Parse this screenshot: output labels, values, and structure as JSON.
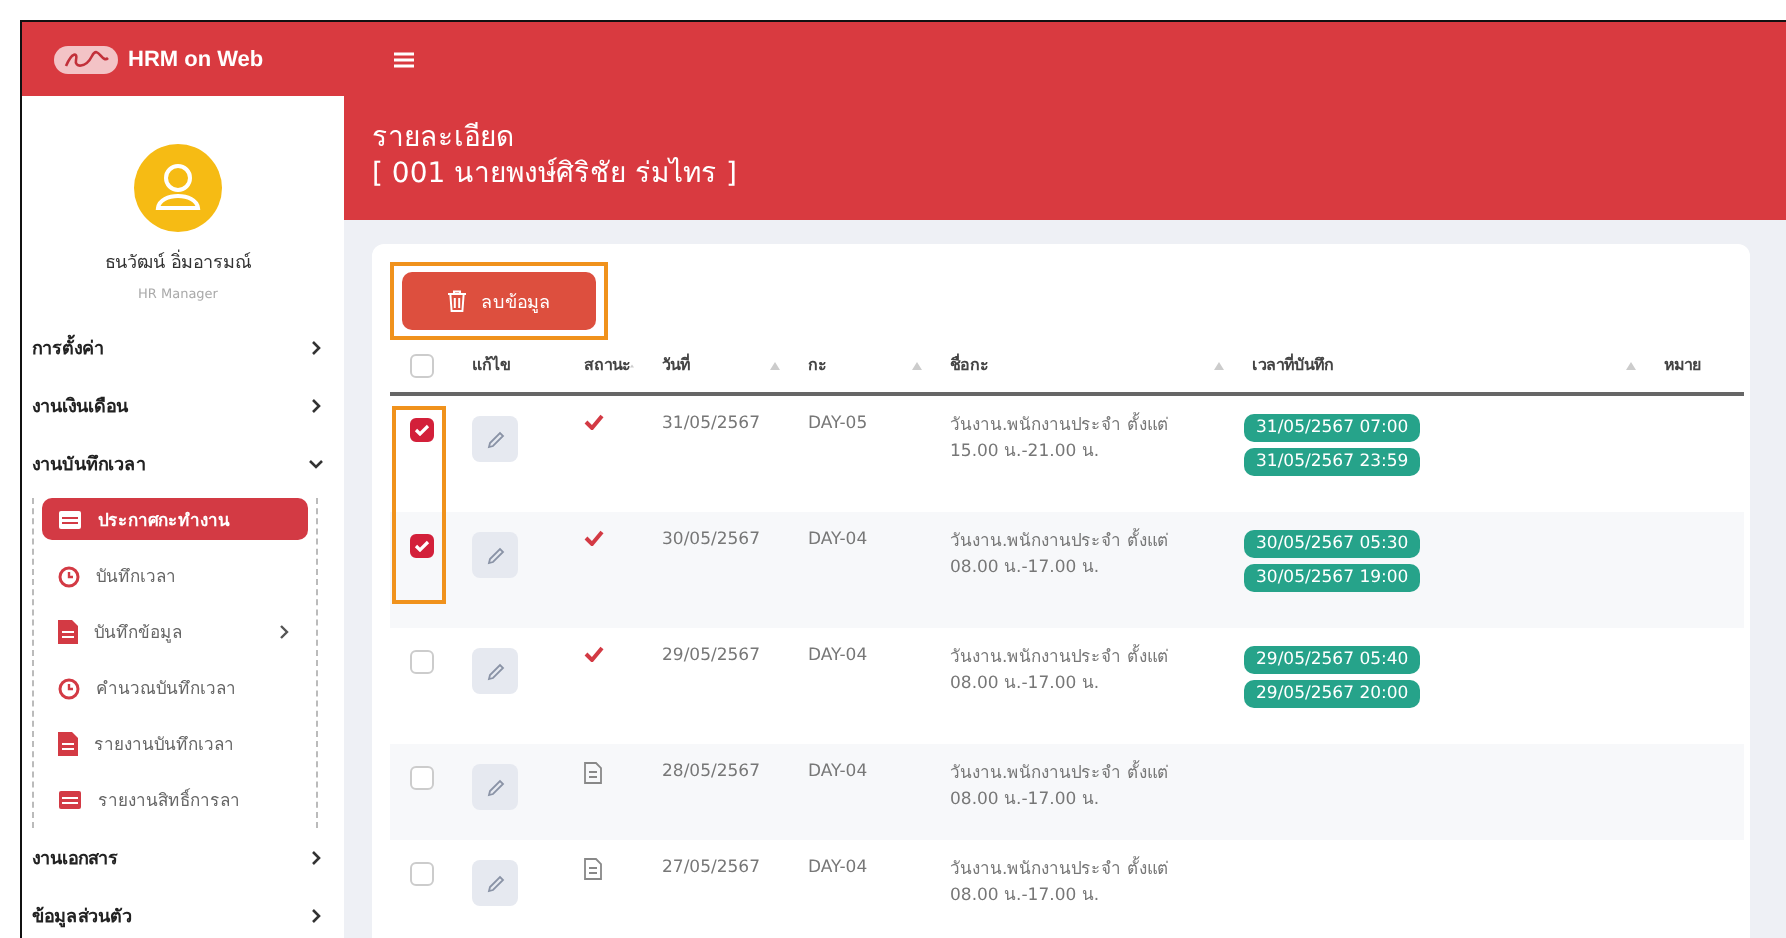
{
  "app": {
    "title": "HRM on Web"
  },
  "profile": {
    "name": "ธนวัฒน์ อิ่มอารมณ์",
    "role": "HR Manager"
  },
  "sidebar": {
    "items": [
      {
        "label": "การตั้งค่า",
        "expanded": false
      },
      {
        "label": "งานเงินเดือน",
        "expanded": false
      },
      {
        "label": "งานบันทึกเวลา",
        "expanded": true,
        "children": [
          {
            "label": "ประกาศกะทำงาน",
            "selected": true
          },
          {
            "label": "บันทึกเวลา",
            "selected": false
          },
          {
            "label": "บันทึกข้อมูล",
            "selected": false,
            "expanded": false
          },
          {
            "label": "คำนวณบันทึกเวลา",
            "selected": false
          },
          {
            "label": "รายงานบันทึกเวลา",
            "selected": false
          },
          {
            "label": "รายงานสิทธิ์การลา",
            "selected": false
          }
        ]
      },
      {
        "label": "งานเอกสาร",
        "expanded": false
      },
      {
        "label": "ข้อมูลส่วนตัว",
        "expanded": false
      }
    ]
  },
  "header": {
    "title": "รายละเอียด",
    "subtitle": "[ 001 นายพงษ์ศิริชัย ร่มไทร ]"
  },
  "toolbar": {
    "delete_button": "ลบข้อมูล"
  },
  "table": {
    "all_selected": false,
    "columns": [
      "แก้ไข",
      "สถานะ",
      "วันที่",
      "กะ",
      "ชื่อกะ",
      "เวลาที่บันทึก",
      "หมาย"
    ],
    "rows": [
      {
        "selected": true,
        "approved": true,
        "date": "31/05/2567",
        "shift": "DAY-05",
        "shift_name": "วันงาน.พนักงานประจำ ตั้งแต่ 15.00 น.-21.00 น.",
        "times": [
          "31/05/2567 07:00",
          "31/05/2567 23:59"
        ]
      },
      {
        "selected": true,
        "approved": true,
        "date": "30/05/2567",
        "shift": "DAY-04",
        "shift_name": "วันงาน.พนักงานประจำ ตั้งแต่ 08.00 น.-17.00 น.",
        "times": [
          "30/05/2567 05:30",
          "30/05/2567 19:00"
        ]
      },
      {
        "selected": false,
        "approved": true,
        "date": "29/05/2567",
        "shift": "DAY-04",
        "shift_name": "วันงาน.พนักงานประจำ ตั้งแต่ 08.00 น.-17.00 น.",
        "times": [
          "29/05/2567 05:40",
          "29/05/2567 20:00"
        ]
      },
      {
        "selected": false,
        "approved": false,
        "date": "28/05/2567",
        "shift": "DAY-04",
        "shift_name": "วันงาน.พนักงานประจำ ตั้งแต่ 08.00 น.-17.00 น.",
        "times": []
      },
      {
        "selected": false,
        "approved": false,
        "date": "27/05/2567",
        "shift": "DAY-04",
        "shift_name": "วันงาน.พนักงานประจำ ตั้งแต่ 08.00 น.-17.00 น.",
        "times": []
      }
    ]
  }
}
